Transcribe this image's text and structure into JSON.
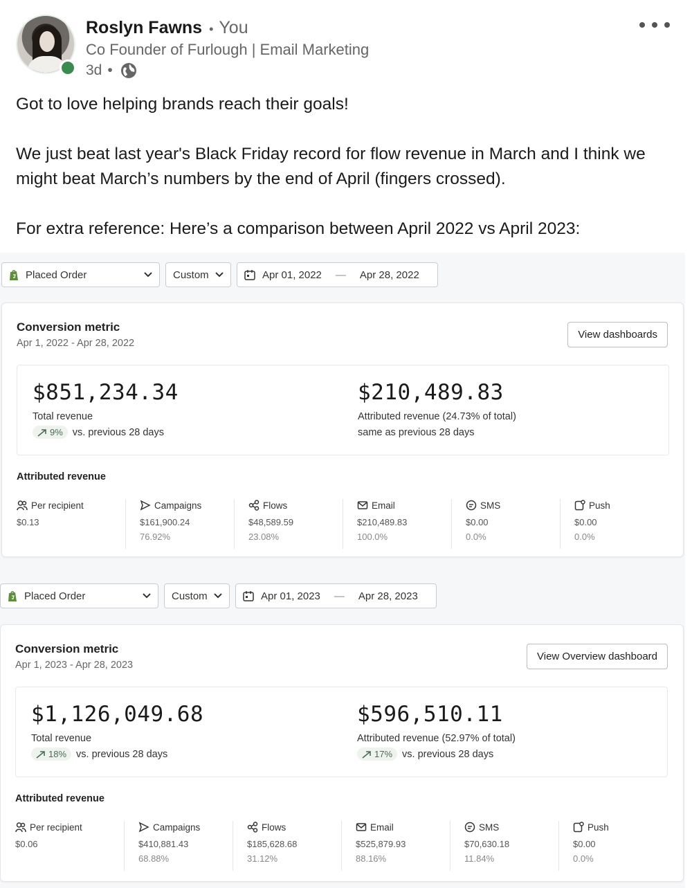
{
  "post": {
    "author": "Roslyn Fawns",
    "relation": "You",
    "headline": "Co Founder of Furlough | Email Marketing",
    "time": "3d",
    "text": [
      "Got to love helping brands reach their goals!",
      "We just beat last year's Black Friday record for flow revenue in March and I think we might beat March’s numbers by the end of April (fingers crossed).",
      "For extra reference: Here’s a comparison between April 2022 vs April 2023:"
    ]
  },
  "dashboards": [
    {
      "metric_select": "Placed Order",
      "range_type": "Custom",
      "range_start": "Apr 01, 2022",
      "range_end": "Apr 28, 2022",
      "title": "Conversion metric",
      "date_range": "Apr 1, 2022 - Apr 28, 2022",
      "button": "View dashboards",
      "total_revenue": "$851,234.34",
      "total_label": "Total revenue",
      "total_delta_pct": "9%",
      "total_delta_text": "vs. previous 28 days",
      "attributed_revenue": "$210,489.83",
      "attributed_label": "Attributed revenue (24.73% of total)",
      "attributed_delta_pct": "",
      "attributed_delta_text": "same as previous 28 days",
      "attr_title": "Attributed revenue",
      "columns": [
        {
          "label": "Per recipient",
          "value": "$0.13",
          "pct": ""
        },
        {
          "label": "Campaigns",
          "value": "$161,900.24",
          "pct": "76.92%"
        },
        {
          "label": "Flows",
          "value": "$48,589.59",
          "pct": "23.08%"
        },
        {
          "label": "Email",
          "value": "$210,489.83",
          "pct": "100.0%"
        },
        {
          "label": "SMS",
          "value": "$0.00",
          "pct": "0.0%"
        },
        {
          "label": "Push",
          "value": "$0.00",
          "pct": "0.0%"
        }
      ]
    },
    {
      "metric_select": "Placed Order",
      "range_type": "Custom",
      "range_start": "Apr 01, 2023",
      "range_end": "Apr 28, 2023",
      "title": "Conversion metric",
      "date_range": "Apr 1, 2023 - Apr 28, 2023",
      "button": "View Overview dashboard",
      "total_revenue": "$1,126,049.68",
      "total_label": "Total revenue",
      "total_delta_pct": "18%",
      "total_delta_text": "vs. previous 28 days",
      "attributed_revenue": "$596,510.11",
      "attributed_label": "Attributed revenue (52.97% of total)",
      "attributed_delta_pct": "17%",
      "attributed_delta_text": "vs. previous 28 days",
      "attr_title": "Attributed revenue",
      "columns": [
        {
          "label": "Per recipient",
          "value": "$0.06",
          "pct": ""
        },
        {
          "label": "Campaigns",
          "value": "$410,881.43",
          "pct": "68.88%"
        },
        {
          "label": "Flows",
          "value": "$185,628.68",
          "pct": "31.12%"
        },
        {
          "label": "Email",
          "value": "$525,879.93",
          "pct": "88.16%"
        },
        {
          "label": "SMS",
          "value": "$70,630.18",
          "pct": "11.84%"
        },
        {
          "label": "Push",
          "value": "$0.00",
          "pct": "0.0%"
        }
      ]
    }
  ],
  "colors": {
    "online": "#3b8a4f",
    "delta_pill_bg": "#eef3ee",
    "delta_pill_text": "#4b6b53"
  }
}
